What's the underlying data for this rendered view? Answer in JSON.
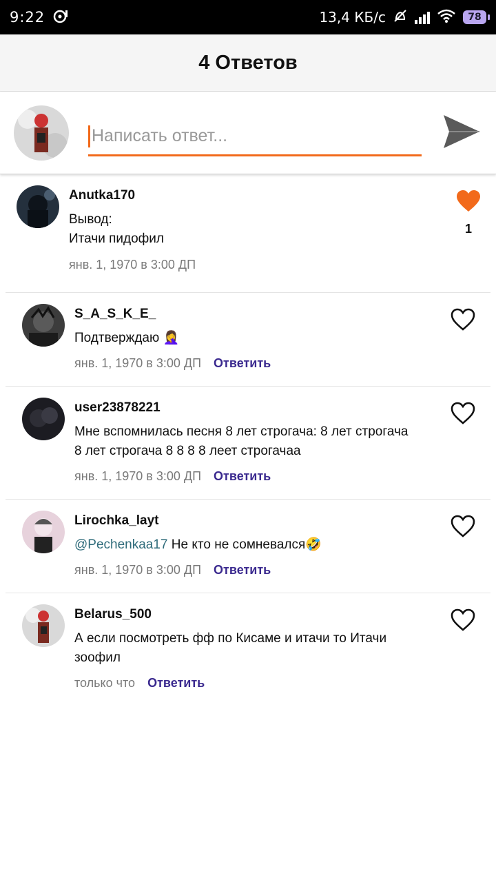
{
  "status_bar": {
    "time": "9:22",
    "network_speed": "13,4 КБ/с",
    "battery": "78"
  },
  "header": {
    "title": "4 Ответов"
  },
  "composer": {
    "placeholder": "Написать ответ...",
    "accent_color": "#f26a1b"
  },
  "top_comment": {
    "username": "Anutka170",
    "text_line1": "Вывод:",
    "text_line2": "Итачи пидофил",
    "timestamp": "янв. 1, 1970 в 3:00 ДП",
    "like_count": "1",
    "liked": true
  },
  "replies": [
    {
      "username": "S_A_S_K_E_",
      "text": "Подтверждаю 🤦‍♀️",
      "timestamp": "янв. 1, 1970 в 3:00 ДП",
      "reply_label": "Ответить"
    },
    {
      "username": "user23878221",
      "text": "Мне вспомнилась песня 8 лет строгача: 8 лет строгача 8 лет строгача 8 8 8 8 леет строгачаа",
      "timestamp": "янв. 1, 1970 в 3:00 ДП",
      "reply_label": "Ответить"
    },
    {
      "username": "Lirochka_layt",
      "mention": "@Pechenkaa17",
      "text": " Не кто не сомневался🤣",
      "timestamp": "янв. 1, 1970 в 3:00 ДП",
      "reply_label": "Ответить"
    },
    {
      "username": "Belarus_500",
      "text": "А если посмотреть фф по Кисаме и итачи то Итачи зоофил",
      "timestamp": "только что",
      "reply_label": "Ответить"
    }
  ]
}
